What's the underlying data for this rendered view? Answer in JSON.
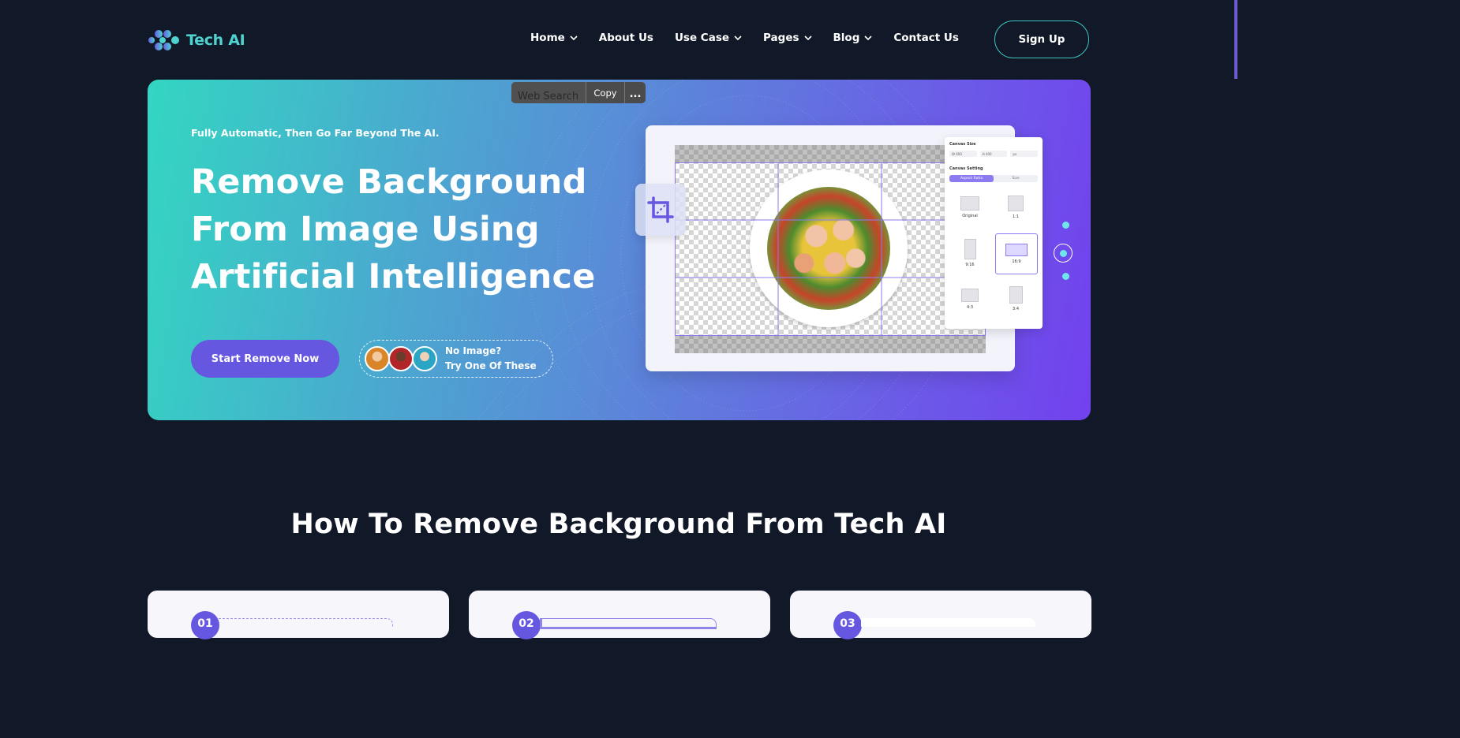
{
  "brand": {
    "name": "Tech AI",
    "accent": "#4ed3d0",
    "primary": "#6657e0"
  },
  "nav": {
    "items": [
      {
        "label": "Home",
        "dropdown": true
      },
      {
        "label": "About Us",
        "dropdown": false
      },
      {
        "label": "Use Case",
        "dropdown": true
      },
      {
        "label": "Pages",
        "dropdown": true
      },
      {
        "label": "Blog",
        "dropdown": true
      },
      {
        "label": "Contact Us",
        "dropdown": false
      }
    ],
    "signup_label": "Sign Up"
  },
  "hero": {
    "kicker": "Fully Automatic, Then Go Far Beyond The AI.",
    "title_line1": "Remove Background",
    "title_line2": "From Image Using",
    "title_line3": "Artificial Intelligence",
    "cta_label": "Start Remove Now",
    "try_line1": "No Image?",
    "try_line2": "Try One Of These",
    "slider_dots": 3,
    "active_dot": 2
  },
  "mockup": {
    "context_menu": {
      "search_label": "Web Search",
      "copy_label": "Copy",
      "more_label": "..."
    },
    "panel": {
      "title": "Canvas Size",
      "field_w": "W",
      "field_w_val": "600",
      "field_h": "H",
      "field_h_val": "400",
      "unit": "px",
      "setting_title": "Canvas Setting",
      "seg_aspect": "Aspect Ratio",
      "seg_size": "Size",
      "ratios": [
        {
          "label": "Original"
        },
        {
          "label": "1:1"
        },
        {
          "label": "9:16"
        },
        {
          "label": "16:9",
          "selected": true
        },
        {
          "label": "4:3"
        },
        {
          "label": "3:4"
        }
      ]
    }
  },
  "how": {
    "title": "How To Remove Background From Tech AI",
    "steps": [
      {
        "number": "01"
      },
      {
        "number": "02"
      },
      {
        "number": "03"
      }
    ]
  }
}
